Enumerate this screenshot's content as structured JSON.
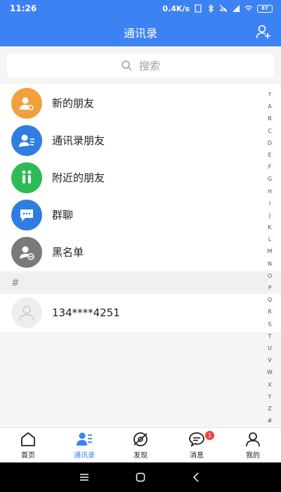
{
  "status": {
    "time": "11:26",
    "speed": "0.4K/s",
    "battery": "87"
  },
  "header": {
    "title": "通讯录"
  },
  "search": {
    "placeholder": "搜索"
  },
  "menu": [
    {
      "label": "新的朋友",
      "color": "#f0a03c",
      "icon": "new-friend-icon"
    },
    {
      "label": "通讯录朋友",
      "color": "#2f7de1",
      "icon": "contacts-friend-icon"
    },
    {
      "label": "附近的朋友",
      "color": "#2dbb55",
      "icon": "nearby-icon"
    },
    {
      "label": "群聊",
      "color": "#2f7de1",
      "icon": "group-chat-icon"
    },
    {
      "label": "黑名单",
      "color": "#7a7a7a",
      "icon": "blacklist-icon"
    }
  ],
  "section": {
    "header": "#"
  },
  "contacts": [
    {
      "name": "134****4251"
    }
  ],
  "index_letters": [
    "↑",
    "A",
    "B",
    "C",
    "D",
    "E",
    "F",
    "G",
    "H",
    "I",
    "J",
    "K",
    "L",
    "M",
    "N",
    "O",
    "P",
    "Q",
    "R",
    "S",
    "T",
    "U",
    "V",
    "W",
    "X",
    "Y",
    "Z",
    "#"
  ],
  "tabs": [
    {
      "label": "首页"
    },
    {
      "label": "通讯录",
      "active": true
    },
    {
      "label": "发现"
    },
    {
      "label": "消息",
      "badge": "1"
    },
    {
      "label": "我的"
    }
  ],
  "colors": {
    "primary": "#3d82f2",
    "badge": "#f04141"
  }
}
